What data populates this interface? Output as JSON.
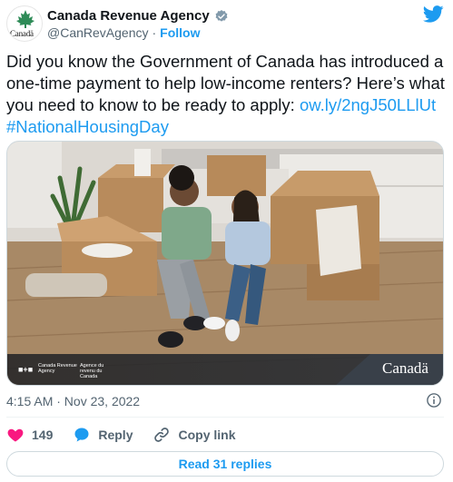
{
  "author": {
    "display_name": "Canada Revenue Agency",
    "handle": "@CanRevAgency",
    "separator": "·",
    "follow_label": "Follow",
    "avatar_text": "Canadä",
    "verified": true
  },
  "tweet": {
    "text_before_link": "Did you know the Government of Canada has introduced a one-time payment to help low-income renters? Here’s what you need to know to be ready to apply: ",
    "link_text": "ow.ly/2ngJ50LLlUt",
    "hashtag": "#NationalHousingDay"
  },
  "media": {
    "gov_label_en": "Canada Revenue Agency",
    "gov_label_fr": "Agence du revenu du Canada",
    "wordmark": "Canadä",
    "flag_glyph": "■+■"
  },
  "meta": {
    "timestamp": "4:15 AM · Nov 23, 2022"
  },
  "actions": {
    "like_count": "149",
    "reply_label": "Reply",
    "copy_link_label": "Copy link"
  },
  "replies_button": {
    "label": "Read 31 replies"
  },
  "icons": {
    "brand": "twitter-bird-icon",
    "verified": "verified-badge-icon",
    "info": "info-icon",
    "like": "heart-icon",
    "reply": "speech-bubble-icon",
    "copy_link": "link-icon"
  },
  "colors": {
    "accent": "#1d9bf0",
    "like": "#f91880",
    "secondary_text": "#536471",
    "primary_text": "#0f1419"
  }
}
